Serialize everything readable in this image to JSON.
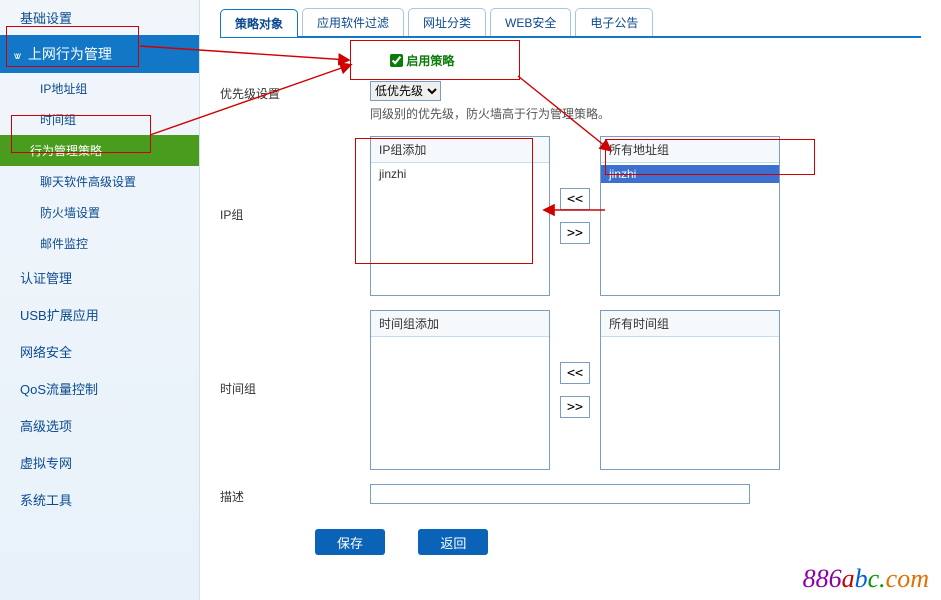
{
  "sidebar": {
    "top_item": "基础设置",
    "expand_header": "上网行为管理",
    "sub_items": [
      {
        "label": "IP地址组"
      },
      {
        "label": "时间组"
      },
      {
        "label": "行为管理策略",
        "active": true
      },
      {
        "label": "聊天软件高级设置"
      },
      {
        "label": "防火墙设置"
      },
      {
        "label": "邮件监控"
      }
    ],
    "sections": [
      "认证管理",
      "USB扩展应用",
      "网络安全",
      "QoS流量控制",
      "高级选项",
      "虚拟专网",
      "系统工具"
    ]
  },
  "tabs": [
    {
      "label": "策略对象",
      "active": true
    },
    {
      "label": "应用软件过滤"
    },
    {
      "label": "网址分类"
    },
    {
      "label": "WEB安全"
    },
    {
      "label": "电子公告"
    }
  ],
  "form": {
    "enable_label": "启用策略",
    "enable_checked": true,
    "priority_label": "优先级设置",
    "priority_value": "低优先级",
    "priority_hint": "同级别的优先级，防火墙高于行为管理策略。",
    "ipgroup_label": "IP组",
    "ipgroup_add_header": "IP组添加",
    "ipgroup_add_items": [
      "jinzhi"
    ],
    "all_addr_header": "所有地址组",
    "all_addr_items": [
      {
        "label": "jinzhi",
        "selected": true
      }
    ],
    "move_left": "<<",
    "move_right": ">>",
    "timegroup_label": "时间组",
    "timegroup_add_header": "时间组添加",
    "timegroup_add_items": [],
    "all_time_header": "所有时间组",
    "all_time_items": [],
    "desc_label": "描述",
    "desc_value": "",
    "save_label": "保存",
    "back_label": "返回"
  },
  "watermark": {
    "p1": "886",
    "p2": "a",
    "p3": "b",
    "p4": "c.",
    "p5": "com"
  }
}
